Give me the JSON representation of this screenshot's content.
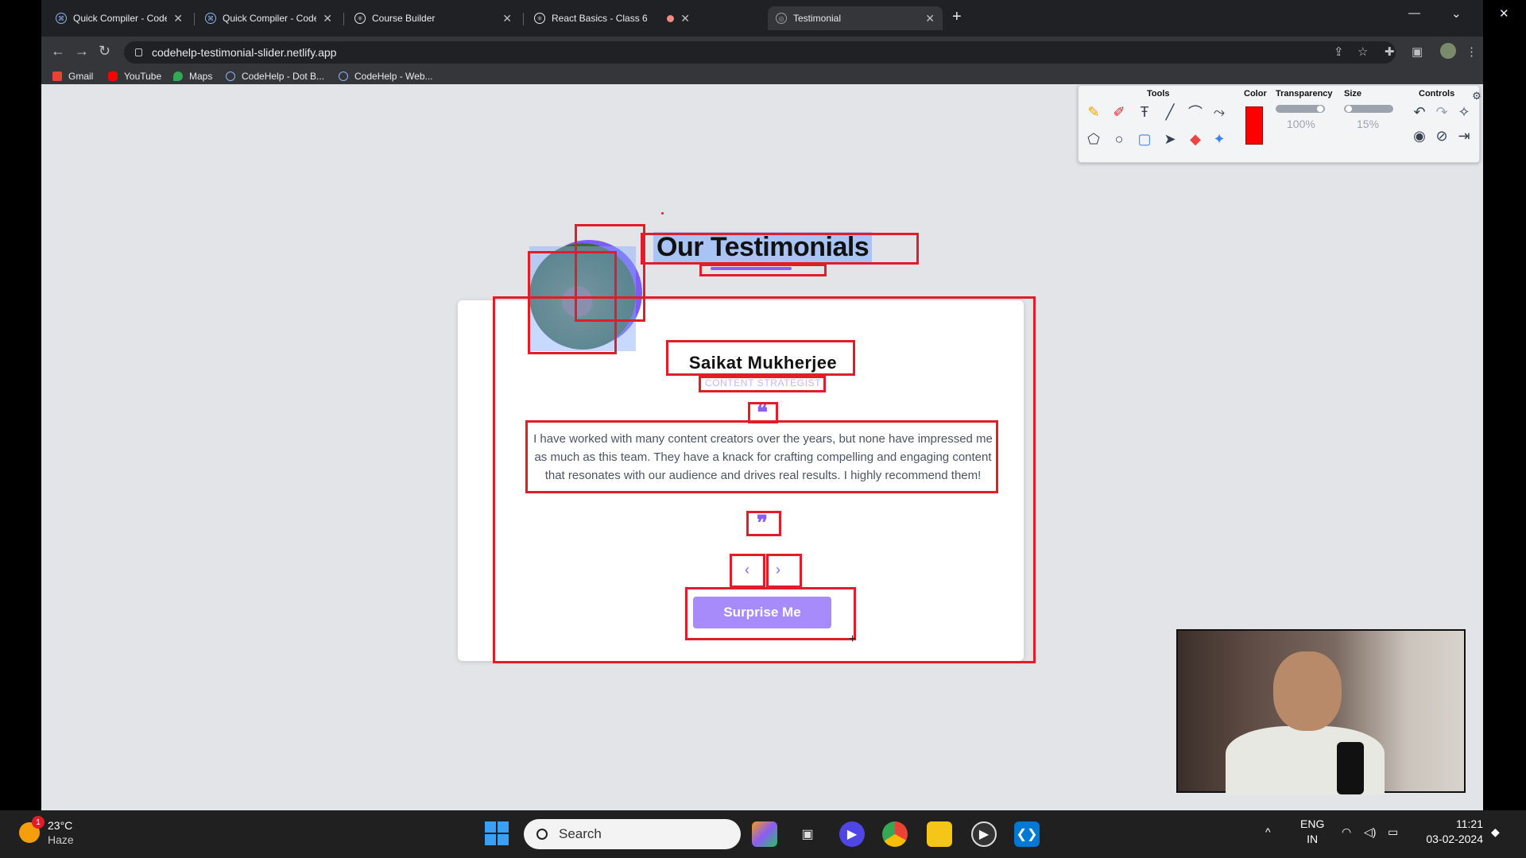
{
  "browser": {
    "tabs": [
      {
        "title": "Quick Compiler - CodeHelp Lab",
        "active": false
      },
      {
        "title": "Quick Compiler - CodeHelp Lab",
        "active": false
      },
      {
        "title": "Course Builder",
        "active": false
      },
      {
        "title": "React Basics - Class 6",
        "active": false
      },
      {
        "title": "Testimonial",
        "active": true
      }
    ],
    "url": "codehelp-testimonial-slider.netlify.app",
    "bookmarks": [
      "Gmail",
      "YouTube",
      "Maps",
      "CodeHelp - Dot B...",
      "CodeHelp - Web..."
    ]
  },
  "page": {
    "heading": "Our Testimonials",
    "testimonial": {
      "name": "Saikat Mukherjee",
      "job": "CONTENT STRATEGIST",
      "text": "I have worked with many content creators over the years, but none have impressed me as much as this team. They have a knack for crafting compelling and engaging content that resonates with our audience and drives real results. I highly recommend them!"
    },
    "open_quote": "❝",
    "close_quote": "❞",
    "prev": "‹",
    "next": "›",
    "surprise_label": "Surprise Me"
  },
  "annotation_panel": {
    "tools_label": "Tools",
    "color_label": "Color",
    "transparency_label": "Transparency",
    "size_label": "Size",
    "controls_label": "Controls",
    "color": "#ff0000",
    "transparency_value": "100%",
    "size_value": "15%"
  },
  "taskbar": {
    "temperature": "23°C",
    "weather": "Haze",
    "weather_badge": "1",
    "search_placeholder": "Search",
    "lang": "ENG",
    "region": "IN",
    "time": "11:21",
    "date": "03-02-2024"
  },
  "colors": {
    "accent": "#8b5cf6",
    "button": "#a78bfa",
    "highlight_box": "#e11d2a"
  }
}
